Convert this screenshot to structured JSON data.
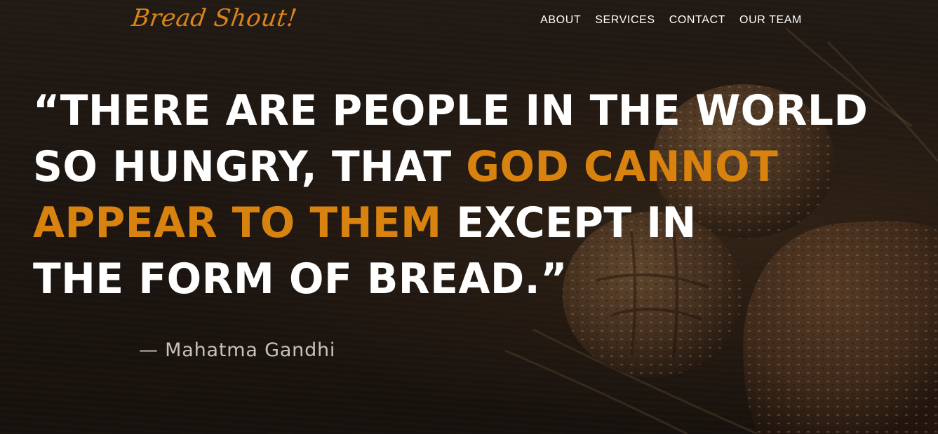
{
  "header": {
    "brand": "Bread Shout!",
    "nav": [
      {
        "label": "ABOUT"
      },
      {
        "label": "SERVICES"
      },
      {
        "label": "CONTACT"
      },
      {
        "label": "OUR TEAM"
      }
    ]
  },
  "hero": {
    "quote": {
      "part1": "“THERE ARE PEOPLE IN THE WORLD SO HUNGRY, THAT ",
      "accent": "GOD CANNOT APPEAR TO THEM",
      "part2": " EXCEPT IN",
      "part3": "THE FORM OF BREAD.”"
    },
    "author": "— Mahatma Gandhi"
  },
  "colors": {
    "accent": "#d8820f",
    "text": "#ffffff",
    "author": "#c9c2bb"
  }
}
